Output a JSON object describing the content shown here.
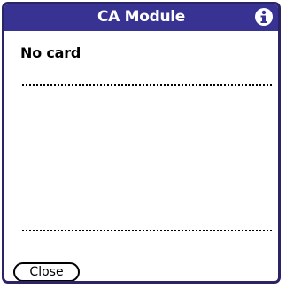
{
  "dialog": {
    "title": "CA Module",
    "icon": "info-icon",
    "status_text": "No card",
    "close_label": "Close"
  },
  "colors": {
    "titlebar": "#383393",
    "frame": "#2a2466",
    "background": "#ffffff",
    "text": "#000000"
  }
}
